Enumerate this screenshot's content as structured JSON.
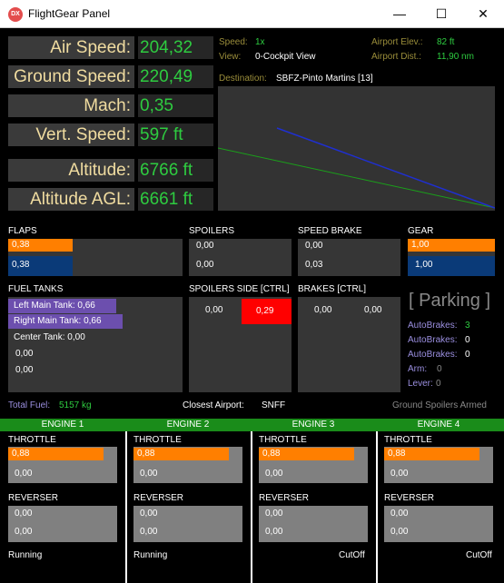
{
  "window": {
    "icon_text": "DX",
    "title": "FlightGear Panel",
    "min": "—",
    "max": "☐",
    "close": "✕"
  },
  "gauges": [
    {
      "label": "Air Speed:",
      "value": "204,32"
    },
    {
      "label": "Ground Speed:",
      "value": "220,49"
    },
    {
      "label": "Mach:",
      "value": "0,35"
    },
    {
      "label": "Vert. Speed:",
      "value": "597 ft"
    },
    {
      "label": "Altitude:",
      "value": "6766 ft"
    },
    {
      "label": "Altitude AGL:",
      "value": "6661 ft"
    }
  ],
  "info": {
    "speed_label": "Speed:",
    "speed_value": "1x",
    "view_label": "View:",
    "view_value": "0-Cockpit View",
    "airport_elev_label": "Airport Elev.:",
    "airport_elev_value": "82 ft",
    "airport_dist_label": "Airport Dist.:",
    "airport_dist_value": "11,90 nm",
    "destination_label": "Destination:",
    "destination_value": "SBFZ-Pinto Martins [13]"
  },
  "flaps": {
    "label": "FLAPS",
    "top": "0,38",
    "bottom": "0,38",
    "fill": 0.38
  },
  "spoilers": {
    "label": "SPOILERS",
    "top": "0,00",
    "bottom": "0,00"
  },
  "speed_brake": {
    "label": "SPEED BRAKE",
    "top": "0,00",
    "bottom": "0,03"
  },
  "gear": {
    "label": "GEAR",
    "top": "1,00",
    "bottom": "1,00",
    "fill": 1.0
  },
  "fuel": {
    "label": "FUEL TANKS",
    "tanks": [
      "Left Main Tank: 0,66",
      "Right Main Tank: 0,66",
      "Center Tank: 0,00",
      "0,00",
      "0,00"
    ]
  },
  "spoilers_side": {
    "label": "SPOILERS SIDE [CTRL]",
    "left": "0,00",
    "right": "0,29"
  },
  "brakes": {
    "label": "BRAKES [CTRL]",
    "left": "0,00",
    "right": "0,00"
  },
  "parking": "[ Parking ]",
  "autobrakes": [
    {
      "label": "AutoBrakes:",
      "value": "3"
    },
    {
      "label": "AutoBrakes:",
      "value": "0"
    },
    {
      "label": "AutoBrakes:",
      "value": "0"
    },
    {
      "label": "Arm:",
      "value": "0"
    },
    {
      "label": "Lever:",
      "value": "0"
    }
  ],
  "status": {
    "total_fuel_label": "Total Fuel:",
    "total_fuel_value": "5157 kg",
    "closest_airport_label": "Closest Airport:",
    "closest_airport_value": "SNFF",
    "spoilers_armed": "Ground Spoilers Armed"
  },
  "engines": [
    {
      "title": "ENGINE 1",
      "throttle_label": "THROTTLE",
      "throttle_top": "0,88",
      "throttle_bottom": "0,00",
      "reverser_label": "REVERSER",
      "rev_top": "0,00",
      "rev_bottom": "0,00",
      "state": "Running",
      "fill": 0.88
    },
    {
      "title": "ENGINE 2",
      "throttle_label": "THROTTLE",
      "throttle_top": "0,88",
      "throttle_bottom": "0,00",
      "reverser_label": "REVERSER",
      "rev_top": "0,00",
      "rev_bottom": "0,00",
      "state": "Running",
      "fill": 0.88
    },
    {
      "title": "ENGINE 3",
      "throttle_label": "THROTTLE",
      "throttle_top": "0,88",
      "throttle_bottom": "0,00",
      "reverser_label": "REVERSER",
      "rev_top": "0,00",
      "rev_bottom": "0,00",
      "state": "CutOff",
      "fill": 0.88
    },
    {
      "title": "ENGINE 4",
      "throttle_label": "THROTTLE",
      "throttle_top": "0,88",
      "throttle_bottom": "0,00",
      "reverser_label": "REVERSER",
      "rev_top": "0,00",
      "rev_bottom": "0,00",
      "state": "CutOff",
      "fill": 0.88
    }
  ],
  "colors": {
    "accent_orange": "#ff7f00",
    "accent_blue": "#0a3a78",
    "value_green": "#2ecc40",
    "label_gold": "#f0dca0",
    "engine_bar": "#1a8c1a",
    "alert_red": "#ff0000"
  }
}
